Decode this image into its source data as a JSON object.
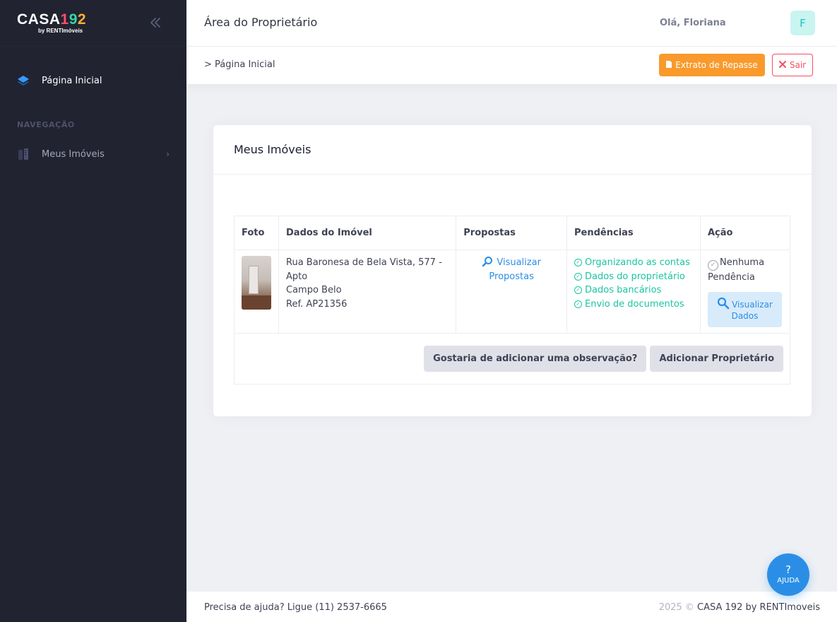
{
  "brand": {
    "logo_word": "CASA",
    "logo_n1": "1",
    "logo_n9": "9",
    "logo_n2": "2",
    "logo_sub": "by RENTImóveis"
  },
  "sidebar": {
    "home_label": "Página Inicial",
    "section_label": "NAVEGAÇÃO",
    "items": [
      {
        "label": "Meus Imóveis"
      }
    ]
  },
  "header": {
    "title": "Área do Proprietário",
    "greeting": "Olá, Floriana",
    "avatar_initial": "F"
  },
  "subheader": {
    "breadcrumb": "> Página Inicial",
    "extrato_label": "Extrato de Repasse",
    "sair_label": "Sair"
  },
  "card": {
    "title": "Meus Imóveis",
    "columns": [
      "Foto",
      "Dados do Imóvel",
      "Propostas",
      "Pendências",
      "Ação"
    ],
    "property": {
      "address": "Rua Baronesa de Bela Vista, 577 - Apto",
      "neighborhood": "Campo Belo",
      "ref": "Ref. AP21356",
      "proposals_link_line1": "Visualizar",
      "proposals_link_line2": "Propostas",
      "pendencias": [
        "Organizando as contas",
        "Dados do proprietário",
        "Dados bancários",
        "Envio de documentos"
      ],
      "acao_status_line1": "Nenhuma",
      "acao_status_line2": "Pendência",
      "view_data_line1": "Visualizar",
      "view_data_line2": "Dados"
    },
    "observation_button": "Gostaria de adicionar uma observação?",
    "add_owner_button": "Adicionar Proprietário"
  },
  "footer": {
    "help_text": "Precisa de ajuda? Ligue (11) 2537-6665",
    "year": "2025 ©",
    "copyright": "CASA 192 by RENTImoveis"
  },
  "help_button": {
    "symbol": "?",
    "label": "AJUDA"
  },
  "colors": {
    "sidebar_bg": "#212330",
    "accent_orange": "#f99a2c",
    "accent_red": "#f64e60",
    "link_blue": "#2b8ee6",
    "success_teal": "#1bc5a0"
  }
}
